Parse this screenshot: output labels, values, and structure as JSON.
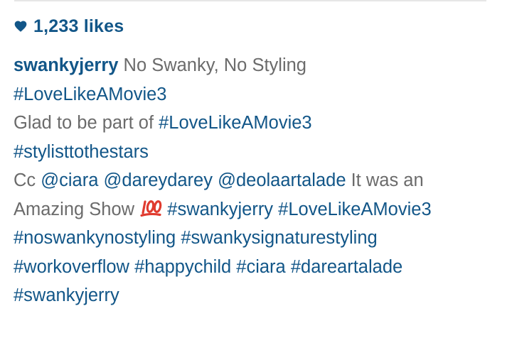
{
  "post": {
    "likes_label": "1,233 likes",
    "heart_color": "#125688",
    "caption": {
      "username": "swankyjerry",
      "line1_text": " No Swanky, No Styling",
      "line2": [
        "#LoveLikeAMovie3"
      ],
      "line3_text": "Glad to be part of ",
      "line3_tag": "#LoveLikeAMovie3",
      "line4": [
        "#stylisttothestars"
      ],
      "line5_text_a": "Cc ",
      "line5_mentions": [
        "@ciara",
        "@dareydarey",
        "@deolaartalade"
      ],
      "line5_text_b": " It was an",
      "line6_text": "Amazing Show ",
      "line6_emoji": "hundred-points-emoji",
      "line6_tags": [
        "#swankyjerry",
        "#LoveLikeAMovie3"
      ],
      "line7_tags": [
        "#noswankynostyling",
        "#swankysignaturestyling"
      ],
      "line8_tags": [
        "#workoverflow",
        "#happychild",
        "#ciara",
        "#dareartalade"
      ],
      "line9_tags": [
        "#swankyjerry"
      ]
    },
    "colors": {
      "link": "#125688",
      "text": "#6b6b6b",
      "emoji": "#e03b2f"
    }
  }
}
